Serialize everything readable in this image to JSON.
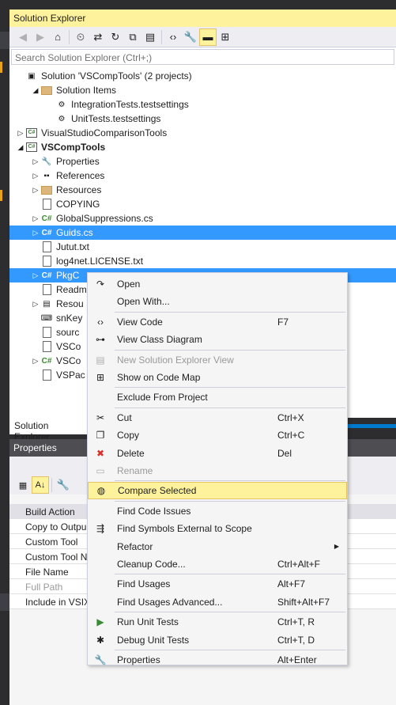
{
  "solution_explorer": {
    "title": "Solution Explorer",
    "search_placeholder": "Search Solution Explorer (Ctrl+;)",
    "bottom_tab": "Solution Explorer",
    "toolbar_icons": [
      "back-icon",
      "forward-icon",
      "home-icon",
      "history-icon",
      "sync-icon",
      "refresh-icon",
      "collapse-all-icon",
      "show-all-files-icon",
      "view-code-icon",
      "properties-icon",
      "preview-selected-icon",
      "pending-changes-icon"
    ],
    "tree": [
      {
        "label": "Solution 'VSCompTools' (2 projects)",
        "expander": "",
        "icon": "solution-icon",
        "indent": 0
      },
      {
        "label": "Solution Items",
        "expander": "◢",
        "icon": "folder-icon",
        "indent": 1
      },
      {
        "label": "IntegrationTests.testsettings",
        "expander": "",
        "icon": "testsettings-icon",
        "indent": 2
      },
      {
        "label": "UnitTests.testsettings",
        "expander": "",
        "icon": "testsettings-icon",
        "indent": 2
      },
      {
        "label": "VisualStudioComparisonTools",
        "expander": "▷",
        "icon": "csharp-project-icon",
        "indent": 0
      },
      {
        "label": "VSCompTools",
        "expander": "◢",
        "icon": "csharp-project-icon",
        "indent": 0,
        "bold": true
      },
      {
        "label": "Properties",
        "expander": "▷",
        "icon": "wrench-icon",
        "indent": 1
      },
      {
        "label": "References",
        "expander": "▷",
        "icon": "references-icon",
        "indent": 1
      },
      {
        "label": "Resources",
        "expander": "▷",
        "icon": "folder-icon",
        "indent": 1
      },
      {
        "label": "COPYING",
        "expander": "",
        "icon": "file-icon",
        "indent": 1
      },
      {
        "label": "GlobalSuppressions.cs",
        "expander": "▷",
        "icon": "csharp-file-icon",
        "indent": 1
      },
      {
        "label": "Guids.cs",
        "expander": "▷",
        "icon": "csharp-file-icon",
        "indent": 1,
        "selected": true
      },
      {
        "label": "Jutut.txt",
        "expander": "",
        "icon": "file-icon",
        "indent": 1
      },
      {
        "label": "log4net.LICENSE.txt",
        "expander": "",
        "icon": "file-icon",
        "indent": 1
      },
      {
        "label": "PkgC",
        "expander": "▷",
        "icon": "csharp-file-icon",
        "indent": 1,
        "selected": true
      },
      {
        "label": "Readm",
        "expander": "",
        "icon": "file-icon",
        "indent": 1
      },
      {
        "label": "Resou",
        "expander": "▷",
        "icon": "resx-icon",
        "indent": 1
      },
      {
        "label": "snKey",
        "expander": "",
        "icon": "key-icon",
        "indent": 1
      },
      {
        "label": "sourc",
        "expander": "",
        "icon": "file-icon",
        "indent": 1
      },
      {
        "label": "VSCo",
        "expander": "",
        "icon": "file-icon",
        "indent": 1
      },
      {
        "label": "VSCo",
        "expander": "▷",
        "icon": "csharp-file-icon",
        "indent": 1
      },
      {
        "label": "VSPac",
        "expander": "",
        "icon": "file-icon",
        "indent": 1
      }
    ]
  },
  "properties": {
    "title": "Properties",
    "rows": [
      "Build Action",
      "Copy to Outpu",
      "Custom Tool",
      "Custom Tool N",
      "File Name",
      "Full Path",
      "Include in VSIX"
    ]
  },
  "context_menu": {
    "items": [
      {
        "type": "item",
        "label": "Open",
        "shortcut": "",
        "icon": "open-icon",
        "glyph": "↷"
      },
      {
        "type": "item",
        "label": "Open With...",
        "shortcut": "",
        "icon": "",
        "glyph": ""
      },
      {
        "type": "sep"
      },
      {
        "type": "item",
        "label": "View Code",
        "shortcut": "F7",
        "icon": "view-code-icon",
        "glyph": "‹›"
      },
      {
        "type": "item",
        "label": "View Class Diagram",
        "shortcut": "",
        "icon": "class-diagram-icon",
        "glyph": "⊶"
      },
      {
        "type": "sep"
      },
      {
        "type": "item",
        "label": "New Solution Explorer View",
        "shortcut": "",
        "icon": "new-view-icon",
        "glyph": "▤",
        "disabled": true
      },
      {
        "type": "item",
        "label": "Show on Code Map",
        "shortcut": "",
        "icon": "code-map-icon",
        "glyph": "⊞"
      },
      {
        "type": "sep"
      },
      {
        "type": "item",
        "label": "Exclude From Project",
        "shortcut": "",
        "icon": "",
        "glyph": ""
      },
      {
        "type": "sep"
      },
      {
        "type": "item",
        "label": "Cut",
        "shortcut": "Ctrl+X",
        "icon": "cut-icon",
        "glyph": "✂"
      },
      {
        "type": "item",
        "label": "Copy",
        "shortcut": "Ctrl+C",
        "icon": "copy-icon",
        "glyph": "❐"
      },
      {
        "type": "item",
        "label": "Delete",
        "shortcut": "Del",
        "icon": "delete-icon",
        "glyph": "✖",
        "red": true
      },
      {
        "type": "item",
        "label": "Rename",
        "shortcut": "",
        "icon": "rename-icon",
        "glyph": "▭",
        "disabled": true
      },
      {
        "type": "sep"
      },
      {
        "type": "item",
        "label": "Compare Selected",
        "shortcut": "",
        "icon": "compare-icon",
        "glyph": "◍",
        "highlighted": true
      },
      {
        "type": "sep"
      },
      {
        "type": "item",
        "label": "Find Code Issues",
        "shortcut": "",
        "icon": "",
        "glyph": ""
      },
      {
        "type": "item",
        "label": "Find Symbols External to Scope",
        "shortcut": "",
        "icon": "find-symbols-icon",
        "glyph": "⇶"
      },
      {
        "type": "item",
        "label": "Refactor",
        "shortcut": "",
        "icon": "",
        "glyph": "",
        "submenu": true
      },
      {
        "type": "item",
        "label": "Cleanup Code...",
        "shortcut": "Ctrl+Alt+F",
        "icon": "",
        "glyph": ""
      },
      {
        "type": "sep"
      },
      {
        "type": "item",
        "label": "Find Usages",
        "shortcut": "Alt+F7",
        "icon": "",
        "glyph": ""
      },
      {
        "type": "item",
        "label": "Find Usages Advanced...",
        "shortcut": "Shift+Alt+F7",
        "icon": "",
        "glyph": ""
      },
      {
        "type": "sep"
      },
      {
        "type": "item",
        "label": "Run Unit Tests",
        "shortcut": "Ctrl+T, R",
        "icon": "run-tests-icon",
        "glyph": "▶",
        "green": true
      },
      {
        "type": "item",
        "label": "Debug Unit Tests",
        "shortcut": "Ctrl+T, D",
        "icon": "debug-tests-icon",
        "glyph": "✱"
      },
      {
        "type": "sep"
      },
      {
        "type": "item",
        "label": "Properties",
        "shortcut": "Alt+Enter",
        "icon": "wrench-icon",
        "glyph": "🔧"
      }
    ]
  }
}
